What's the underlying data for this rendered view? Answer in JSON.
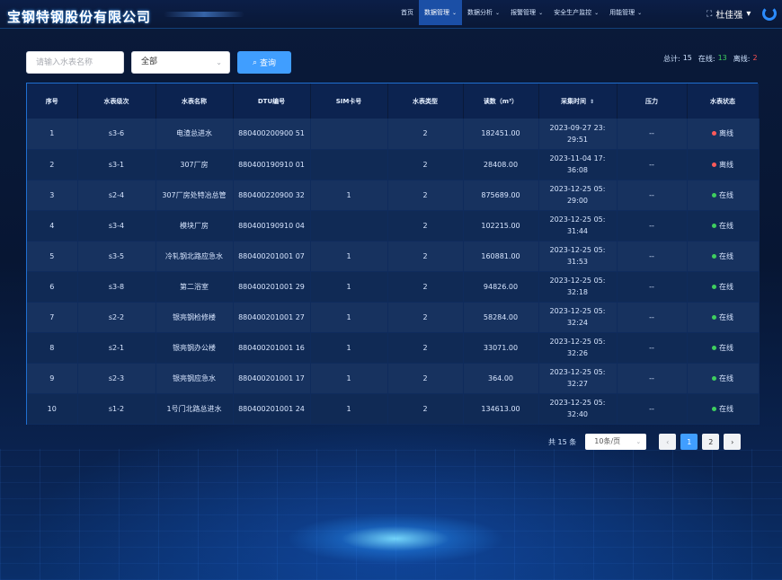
{
  "header": {
    "company": "宝钢特钢股份有限公司",
    "nav": [
      {
        "label": "首页",
        "has_dropdown": false,
        "active": false
      },
      {
        "label": "数据管理",
        "has_dropdown": true,
        "active": true
      },
      {
        "label": "数据分析",
        "has_dropdown": true,
        "active": false
      },
      {
        "label": "报警管理",
        "has_dropdown": true,
        "active": false
      },
      {
        "label": "安全生产监控",
        "has_dropdown": true,
        "active": false
      },
      {
        "label": "用能管理",
        "has_dropdown": true,
        "active": false
      }
    ],
    "user_name": "杜佳强"
  },
  "search": {
    "placeholder": "请输入水表名称",
    "select_value": "全部",
    "query_label": "查询"
  },
  "stats": {
    "total_label": "总计:",
    "total_value": "15",
    "online_label": "在线:",
    "online_value": "13",
    "offline_label": "离线:",
    "offline_value": "2"
  },
  "table": {
    "columns": [
      "序号",
      "水表级次",
      "水表名称",
      "DTU编号",
      "SIM卡号",
      "水表类型",
      "读数（m³）",
      "采集时间",
      "压力",
      "水表状态"
    ],
    "rows": [
      {
        "no": "1",
        "level": "s3-6",
        "name": "电渣总进水",
        "dtu": "880400200900 51",
        "sim": "",
        "type": "2",
        "reading": "182451.00",
        "time": "2023-09-27 23: 29:51",
        "pressure": "--",
        "status": "离线",
        "status_color": "#ff5a5a"
      },
      {
        "no": "2",
        "level": "s3-1",
        "name": "307厂房",
        "dtu": "880400190910 01",
        "sim": "",
        "type": "2",
        "reading": "28408.00",
        "time": "2023-11-04 17: 36:08",
        "pressure": "--",
        "status": "离线",
        "status_color": "#ff5a5a"
      },
      {
        "no": "3",
        "level": "s2-4",
        "name": "307厂房处特冶总管",
        "dtu": "880400220900 32",
        "sim": "1",
        "type": "2",
        "reading": "875689.00",
        "time": "2023-12-25 05: 29:00",
        "pressure": "--",
        "status": "在线",
        "status_color": "#3fcf5f"
      },
      {
        "no": "4",
        "level": "s3-4",
        "name": "模块厂房",
        "dtu": "880400190910 04",
        "sim": "",
        "type": "2",
        "reading": "102215.00",
        "time": "2023-12-25 05: 31:44",
        "pressure": "--",
        "status": "在线",
        "status_color": "#3fcf5f"
      },
      {
        "no": "5",
        "level": "s3-5",
        "name": "冷轧钢北路应急水",
        "dtu": "880400201001 07",
        "sim": "1",
        "type": "2",
        "reading": "160881.00",
        "time": "2023-12-25 05: 31:53",
        "pressure": "--",
        "status": "在线",
        "status_color": "#3fcf5f"
      },
      {
        "no": "6",
        "level": "s3-8",
        "name": "第二浴室",
        "dtu": "880400201001 29",
        "sim": "1",
        "type": "2",
        "reading": "94826.00",
        "time": "2023-12-25 05: 32:18",
        "pressure": "--",
        "status": "在线",
        "status_color": "#3fcf5f"
      },
      {
        "no": "7",
        "level": "s2-2",
        "name": "银亮钢检修楼",
        "dtu": "880400201001 27",
        "sim": "1",
        "type": "2",
        "reading": "58284.00",
        "time": "2023-12-25 05: 32:24",
        "pressure": "--",
        "status": "在线",
        "status_color": "#3fcf5f"
      },
      {
        "no": "8",
        "level": "s2-1",
        "name": "银亮钢办公楼",
        "dtu": "880400201001 16",
        "sim": "1",
        "type": "2",
        "reading": "33071.00",
        "time": "2023-12-25 05: 32:26",
        "pressure": "--",
        "status": "在线",
        "status_color": "#3fcf5f"
      },
      {
        "no": "9",
        "level": "s2-3",
        "name": "银亮钢应急水",
        "dtu": "880400201001 17",
        "sim": "1",
        "type": "2",
        "reading": "364.00",
        "time": "2023-12-25 05: 32:27",
        "pressure": "--",
        "status": "在线",
        "status_color": "#3fcf5f"
      },
      {
        "no": "10",
        "level": "s1-2",
        "name": "1号门北路总进水",
        "dtu": "880400201001 24",
        "sim": "1",
        "type": "2",
        "reading": "134613.00",
        "time": "2023-12-25 05: 32:40",
        "pressure": "--",
        "status": "在线",
        "status_color": "#3fcf5f"
      }
    ]
  },
  "pagination": {
    "total_text": "共 15 条",
    "page_size": "10条/页",
    "pages": [
      "1",
      "2"
    ],
    "current_page": "1"
  },
  "colors": {
    "accent": "#409eff",
    "online": "#3fcf5f",
    "offline": "#ff5a5a"
  }
}
